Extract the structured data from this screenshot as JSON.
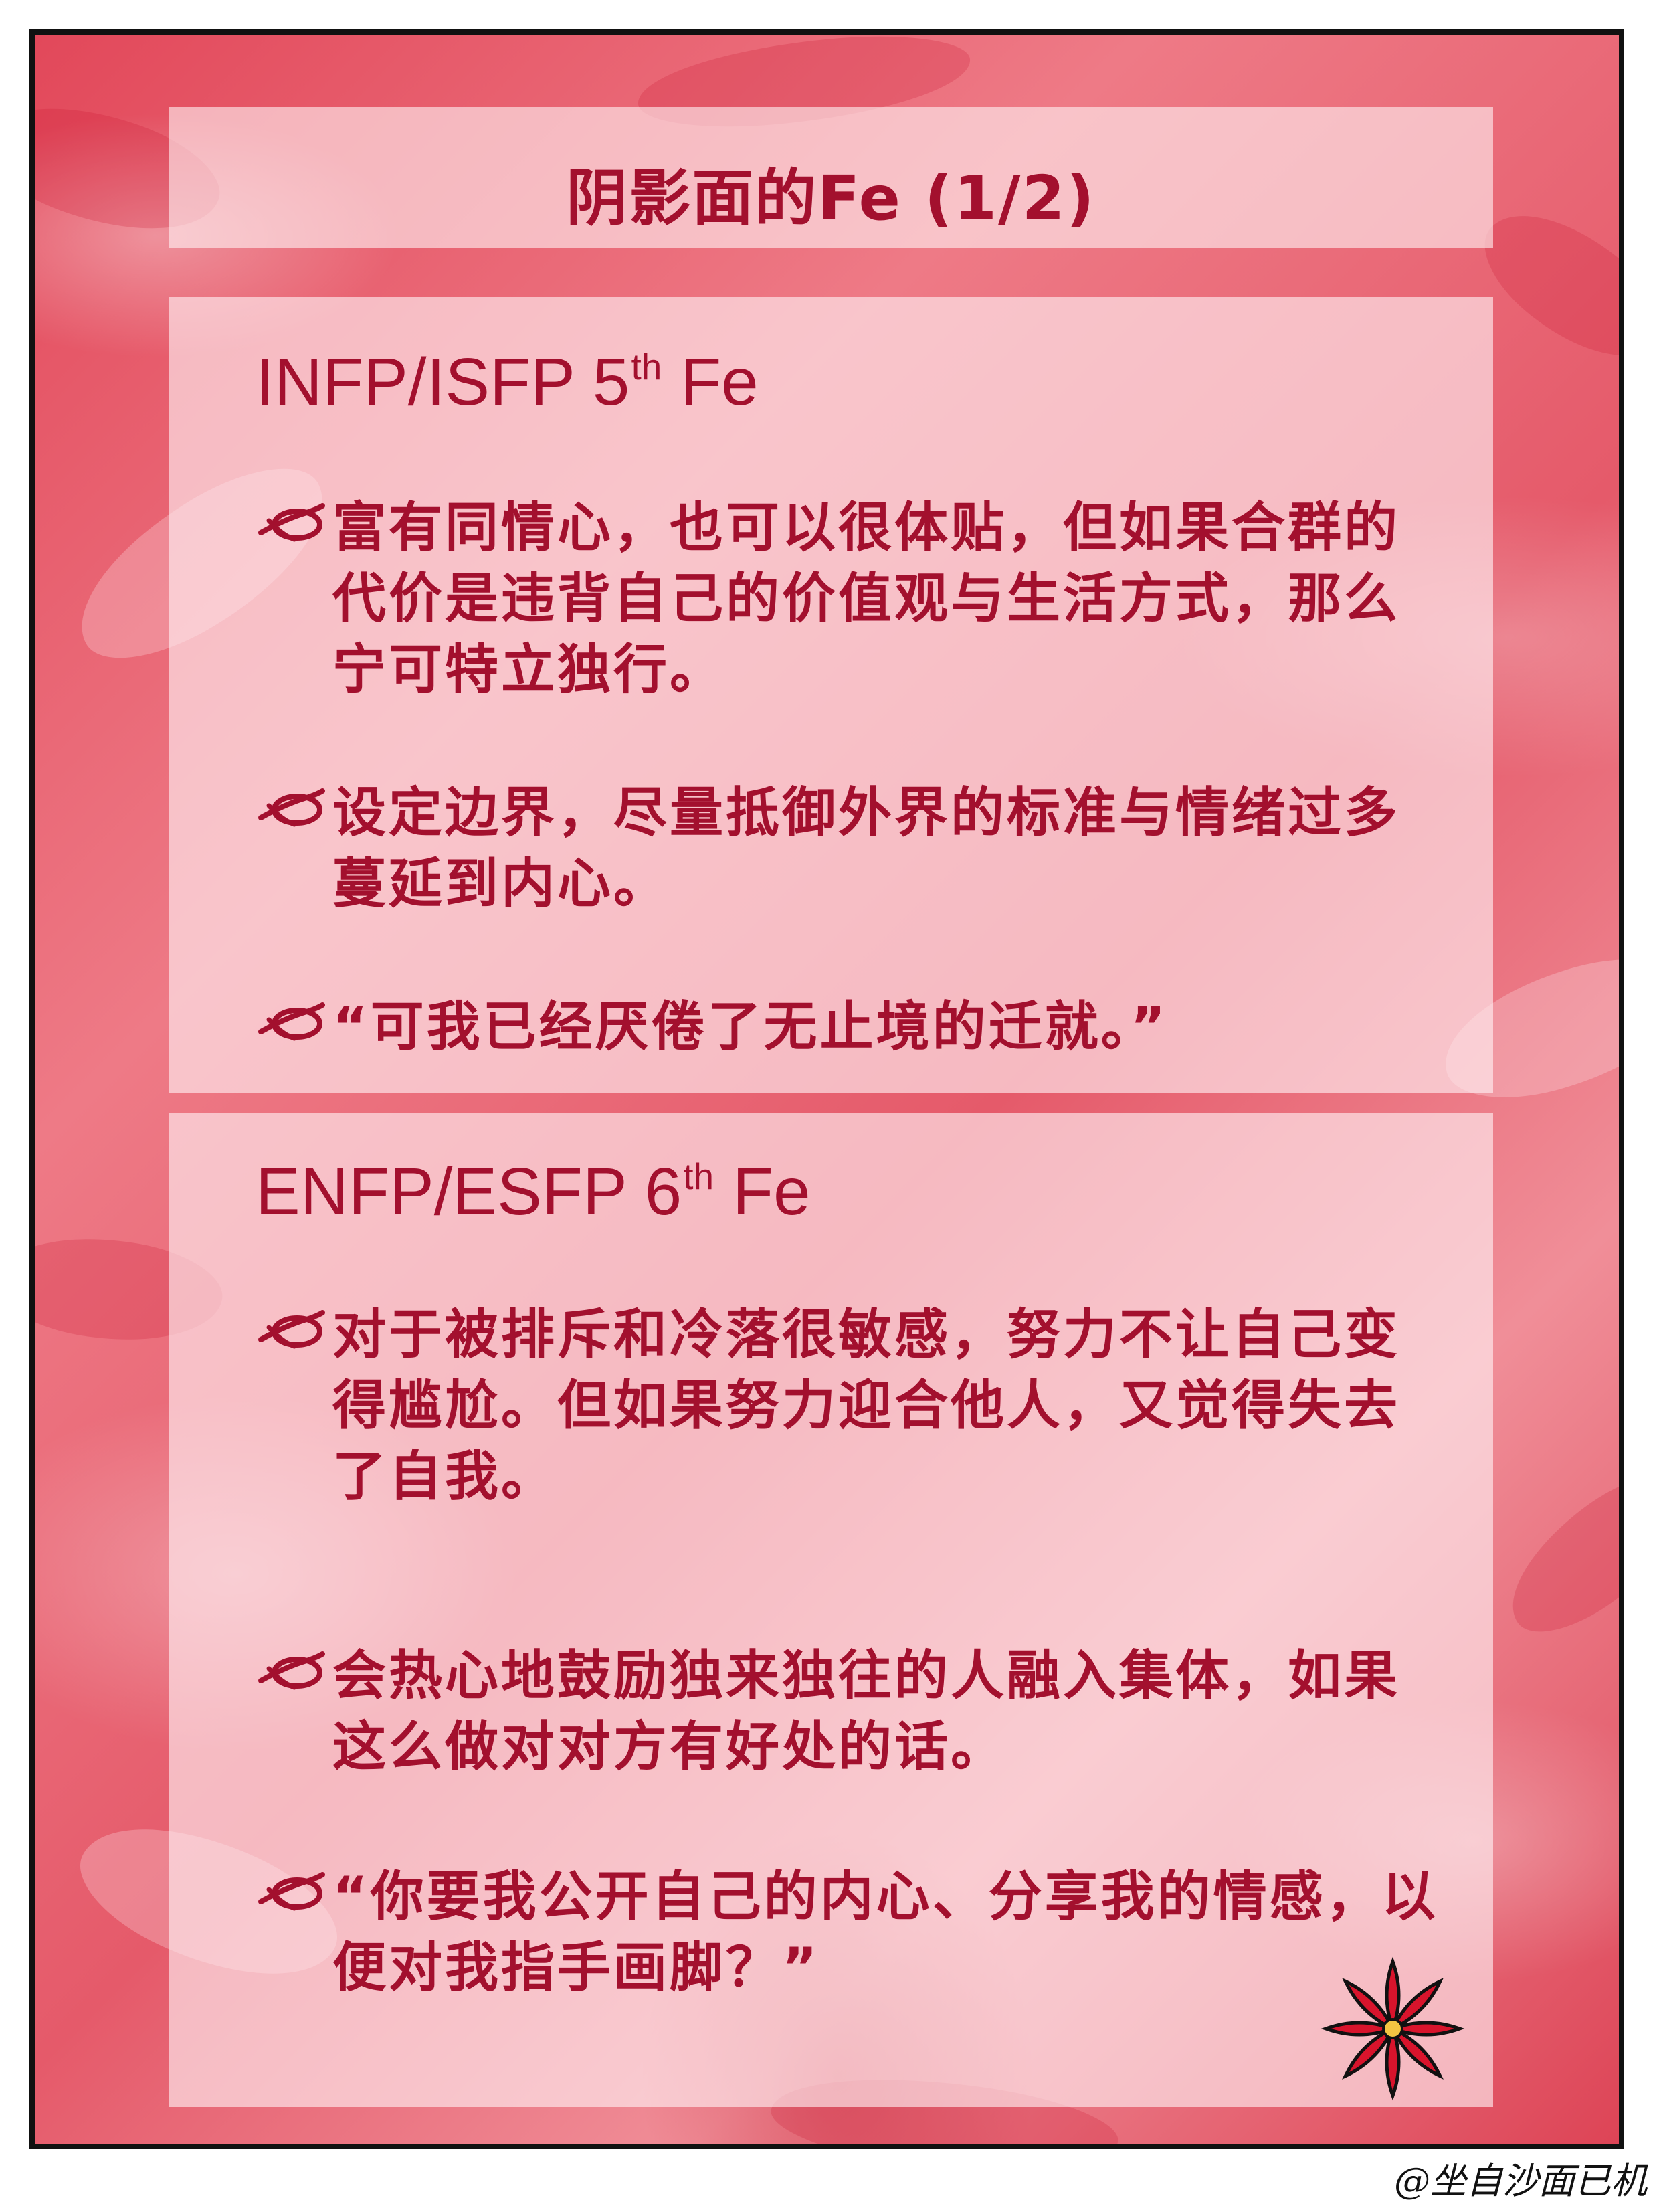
{
  "title": "阴影面的Fe (1/2)",
  "sections": [
    {
      "type_pair": "INFP/ISFP 5",
      "ordinal_suffix": "th",
      "function": " Fe",
      "bullets": [
        "富有同情心，也可以很体贴，但如果合群的代价是违背自己的价值观与生活方式，那么宁可特立独行。",
        "设定边界，尽量抵御外界的标准与情绪过多蔓延到内心。",
        "“可我已经厌倦了无止境的迁就。”"
      ]
    },
    {
      "type_pair": "ENFP/ESFP 6",
      "ordinal_suffix": "th",
      "function": " Fe",
      "bullets": [
        "对于被排斥和冷落很敏感，努力不让自己变得尴尬。但如果努力迎合他人，又觉得失去了自我。",
        "会热心地鼓励独来独往的人融入集体，如果这么做对对方有好处的话。",
        "“你要我公开自己的内心、分享我的情感，以便对我指手画脚？”"
      ]
    }
  ],
  "signature": "@坐自沙面已机",
  "icons": {
    "bullet": "ribbon-loop-icon",
    "corner": "red-flower-icon"
  },
  "colors": {
    "text": "#a3102e",
    "background_red": "#e2485a",
    "panel": "#fff0f2",
    "frame": "#111111"
  }
}
